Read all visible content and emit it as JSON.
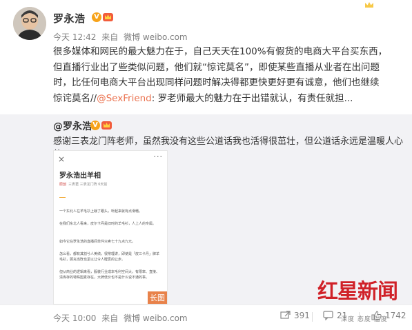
{
  "post": {
    "author": "罗永浩",
    "verified_badge": "V",
    "meta": {
      "time": "今天 12:42",
      "from": "来自",
      "source": "微博 weibo.com"
    },
    "text_lines": [
      "很多媒体和网民的最大魅力在于，自己天天在100%有假货的电商大平台买东西，",
      "但直播行业出了些类似问题，他们就“惊诧莫名”，即使某些直播从业者在出问题",
      "时，比任何电商大平台出现同样问题时解决得都更快更好更有诚意，他们也继续",
      "惊诧莫名//"
    ],
    "mention": "@SexFriend",
    "text_tail": ": 罗老师最大的魅力在于出错就认，有责任就担..."
  },
  "retweet": {
    "author": "@罗永浩",
    "verified_badge": "V",
    "text": "感谢三表龙门阵老师，虽然我没有这些公道话我也活得很茁壮，但公道话永远是温暖人心的。",
    "long_image": {
      "close": "×",
      "more": "···",
      "title": "罗永浩出羊相",
      "source": [
        "原创",
        "三表君",
        "三表龙门阵",
        "6天前"
      ],
      "paragraphs": [
        "一个东北人在羊毛衫上栽了跟头，听起来就有点滑稽。",
        "在我们东北人看来，皮尔卡丹是旧时的羊毛衫，人上人的专属。",
        "如今它在罗永浩的直播间单件只卖七十九点九元。",
        "怎么看，都有其割兮人美绩，很常理讲，即使是「皮三卡丹」牌羊毛衫，顾充当既也足以让令人瞠否的让步。",
        "但从商业的逻辑来看，服装行业成本毛利空间大，有限率、直接、清库存的特殊因素存在，大牌低价也不是什么说不通的事。"
      ],
      "tag": "长图"
    }
  },
  "footer": {
    "meta": {
      "time": "今天 10:00",
      "from": "来自",
      "source": "微博 weibo.com"
    },
    "repost_count": "391",
    "comment_count": "21",
    "like_count": "1742"
  },
  "watermark": {
    "main": "红星新闻",
    "sub": "深度 态度 温度"
  },
  "colors": {
    "link": "#eb7350",
    "badge": "#f7a31a",
    "retweet_bg": "#f2f2f5",
    "watermark": "#d02128"
  }
}
